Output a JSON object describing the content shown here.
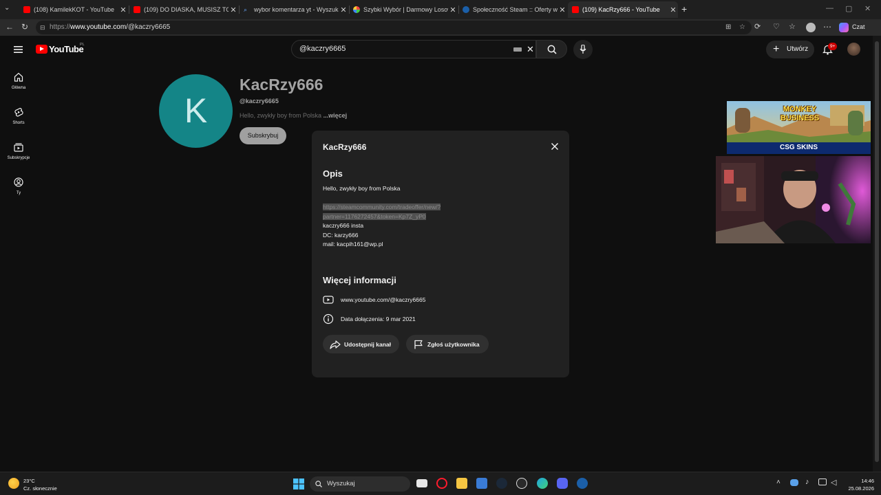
{
  "browser": {
    "tabs": [
      {
        "title": "(108) KamilekKOT - YouTube",
        "favicon": "youtube-icon"
      },
      {
        "title": "(109) DO DIASKA, MUSISZ TO ZOB",
        "favicon": "youtube-icon"
      },
      {
        "title": "wybor komentarza yt - Wyszukaj",
        "favicon": "search-icon"
      },
      {
        "title": "Szybki Wybór | Darmowy Losowy W",
        "favicon": "wheel-icon"
      },
      {
        "title": "Społeczność Steam :: Oferty wymia",
        "favicon": "steam-icon"
      },
      {
        "title": "(109) KacRzy666 - YouTube",
        "favicon": "youtube-icon"
      }
    ],
    "active_tab_index": 5,
    "url_scheme": "https://",
    "url_host": "www.youtube.com",
    "url_path": "/@kaczry6665",
    "chat_label": "Czat"
  },
  "youtube": {
    "logo_text": "YouTube",
    "logo_region": "PL",
    "search_value": "@kaczry6665",
    "create_label": "Utwórz",
    "notifications_badge": "9+",
    "guide": [
      {
        "label": "Główna",
        "icon": "home-icon"
      },
      {
        "label": "Shorts",
        "icon": "shorts-icon"
      },
      {
        "label": "Subskrypcje",
        "icon": "subscriptions-icon"
      },
      {
        "label": "Ty",
        "icon": "you-icon"
      }
    ],
    "channel": {
      "avatar_letter": "K",
      "name": "KacRzy666",
      "handle": "@kaczry6665",
      "description_preview": "Hello, zwykły boy from Polska",
      "more_label": "...więcej",
      "subscribe_label": "Subskrybuj"
    },
    "modal": {
      "title": "KacRzy666",
      "description_heading": "Opis",
      "description_lines": [
        "Hello, zwykły boy from Polska",
        "https://steamcommunity.com/tradeoffer/new/?",
        "partner=1176272457&token=Kp7Z_yP0",
        "kaczry666 insta",
        "DC: karzy666",
        "mail: kacpih161@wp.pl"
      ],
      "more_info_heading": "Więcej informacji",
      "channel_url": "www.youtube.com/@kaczry6665",
      "joined": "Data dołączenia: 9 mar 2021",
      "share_label": "Udostępnij kanał",
      "report_label": "Zgłoś użytkownika"
    },
    "ad": {
      "headline": "MONKEY BUSINESS",
      "brand": "CSG SKINS"
    }
  },
  "taskbar": {
    "temperature": "23°C",
    "weather": "Cz. słonecznie",
    "search_placeholder": "Wyszukaj",
    "time": "14:46",
    "date": "25.08.2026"
  }
}
